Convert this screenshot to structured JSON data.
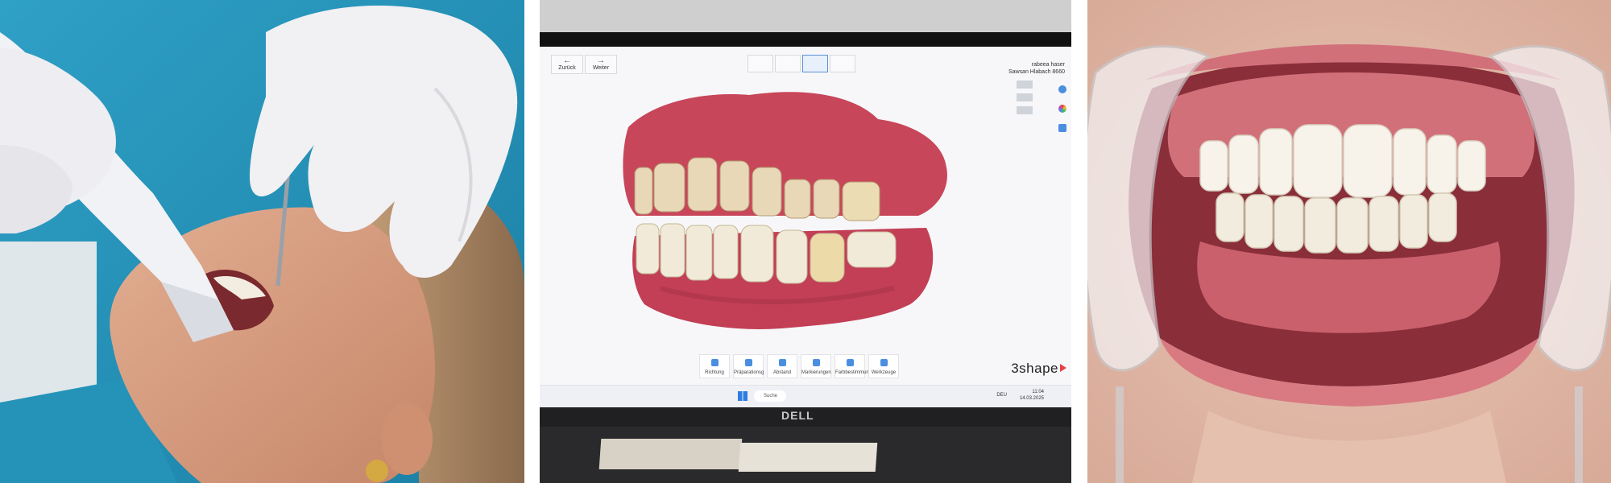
{
  "panels": {
    "left": {
      "subject": "dentist-intraoral-scan"
    },
    "center": {
      "nav": {
        "back_label": "Zurück",
        "next_label": "Weiter"
      },
      "patient": {
        "line1": "rabeea haser",
        "line2": "Sawsan Hlabach 8660"
      },
      "tools": [
        {
          "label": "Richtung"
        },
        {
          "label": "Präparationsg"
        },
        {
          "label": "Abstand"
        },
        {
          "label": "Markierungen"
        },
        {
          "label": "Farbbestimmung"
        },
        {
          "label": "Werkzeuge"
        }
      ],
      "brand": "3shape",
      "taskbar": {
        "search": "Suche",
        "lang": "DEU",
        "time": "11:04",
        "date": "14.03.2025"
      },
      "laptop_brand": "DELL"
    },
    "right": {
      "subject": "smile-with-cheek-retractor"
    }
  },
  "colors": {
    "scrubs": "#3aa3c6",
    "glove": "#ecebef",
    "skin": "#d49a7c",
    "gum": "#c84a5a",
    "tooth": "#f1e6d2",
    "accent": "#4a8ee0",
    "brand_red": "#e34242"
  }
}
